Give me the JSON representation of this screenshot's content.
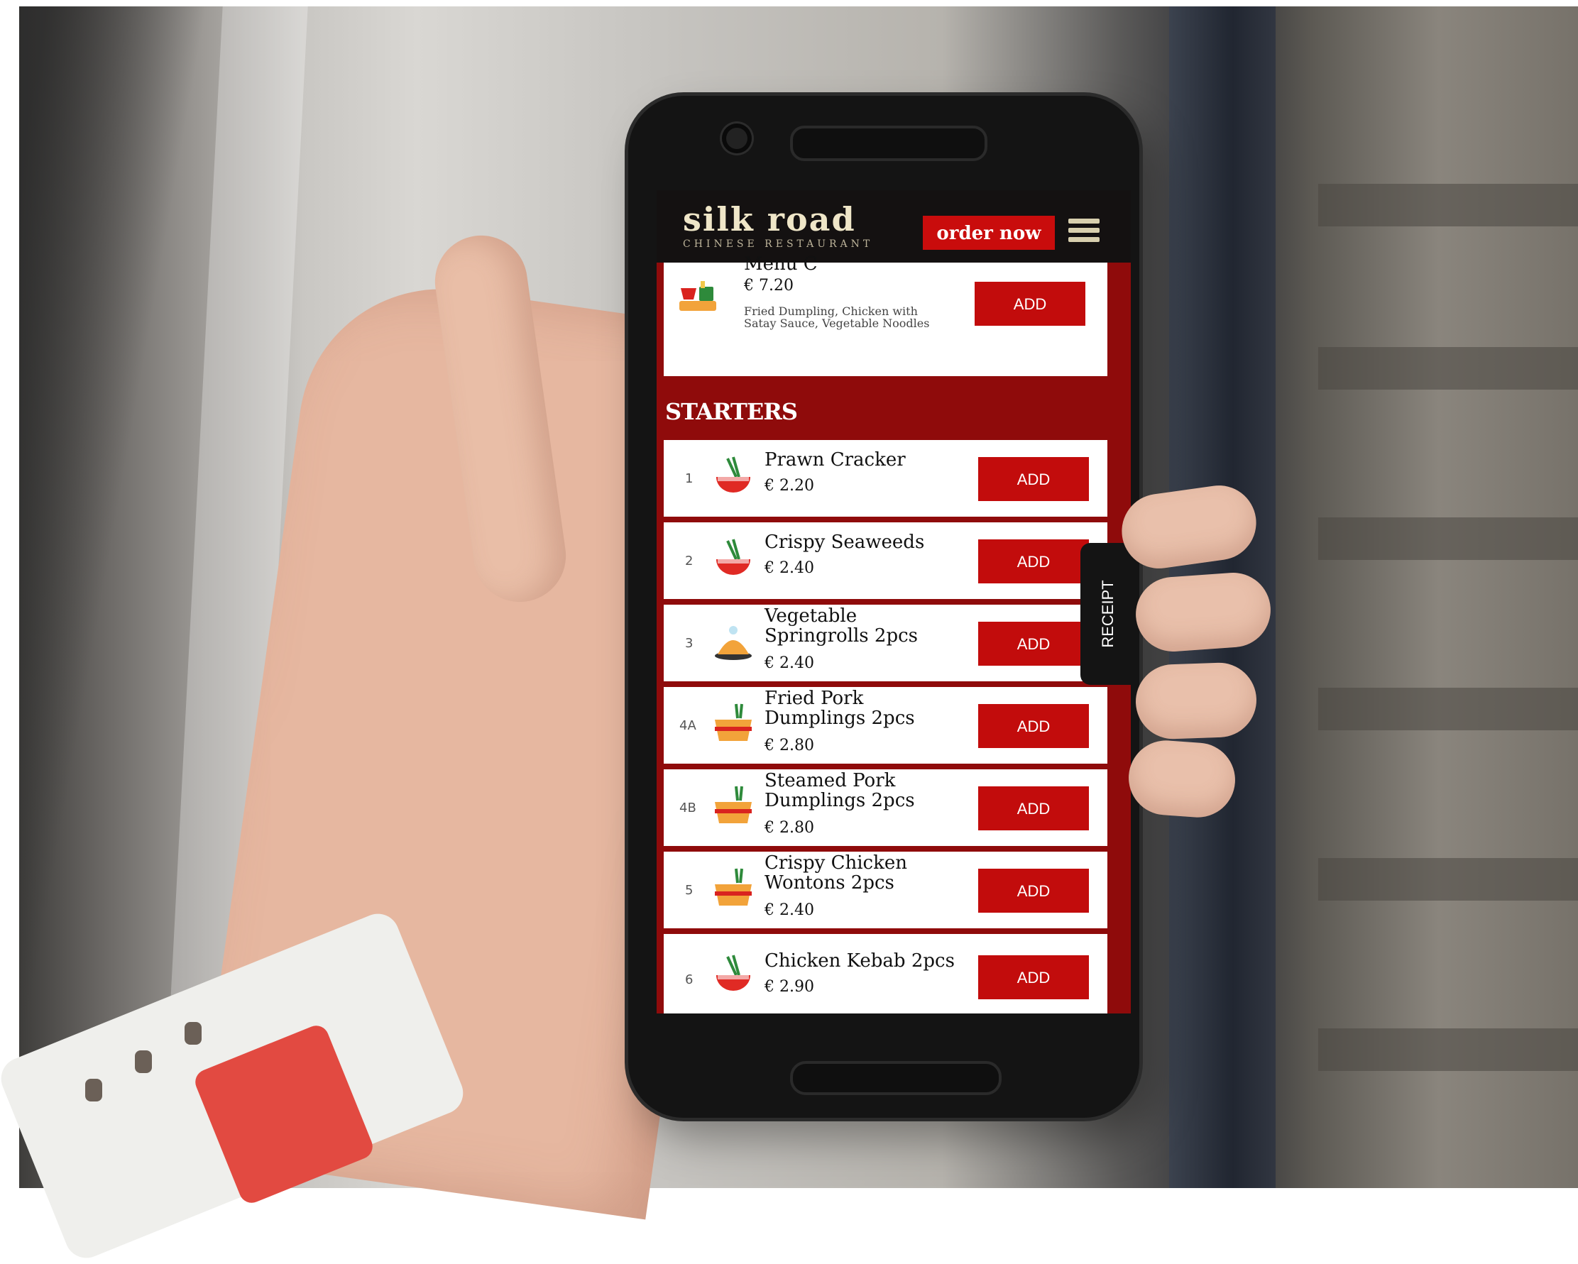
{
  "header": {
    "logo_title": "silk road",
    "logo_subtitle": "CHINESE RESTAURANT",
    "order_button": "order now",
    "menu_icon": "hamburger-menu-icon"
  },
  "top_item": {
    "name": "Menu C",
    "price": "€ 7.20",
    "description": "Fried Dumpling, Chicken with Satay Sauce, Vegetable Noodles",
    "add_label": "ADD",
    "icon": "combo-meal-icon"
  },
  "section": {
    "title": "STARTERS"
  },
  "items": [
    {
      "num": "1",
      "name": "Prawn Cracker",
      "price": "€ 2.20",
      "add_label": "ADD",
      "icon": "noodle-bowl-icon"
    },
    {
      "num": "2",
      "name": "Crispy Seaweeds",
      "price": "€ 2.40",
      "add_label": "ADD",
      "icon": "noodle-bowl-icon"
    },
    {
      "num": "3",
      "name": "Vegetable Springrolls 2pcs",
      "price": "€ 2.40",
      "add_label": "ADD",
      "icon": "dim-sum-plate-icon"
    },
    {
      "num": "4A",
      "name": "Fried Pork Dumplings 2pcs",
      "price": "€ 2.80",
      "add_label": "ADD",
      "icon": "takeaway-box-icon"
    },
    {
      "num": "4B",
      "name": "Steamed Pork Dumplings 2pcs",
      "price": "€ 2.80",
      "add_label": "ADD",
      "icon": "takeaway-box-icon"
    },
    {
      "num": "5",
      "name": "Crispy Chicken Wontons 2pcs",
      "price": "€ 2.40",
      "add_label": "ADD",
      "icon": "takeaway-box-icon"
    },
    {
      "num": "6",
      "name": "Chicken Kebab 2pcs",
      "price": "€ 2.90",
      "add_label": "ADD",
      "icon": "noodle-bowl-icon"
    }
  ],
  "receipt_tab": "RECEIPT",
  "colors": {
    "accent_red": "#c20c0c",
    "header_bg": "#141111",
    "section_bg": "#8f0b0b",
    "logo_cream": "#efe6c8"
  }
}
